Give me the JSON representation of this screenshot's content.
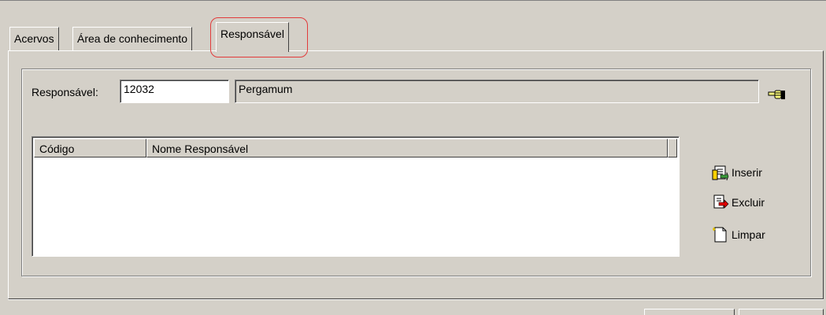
{
  "tabs": [
    {
      "label": "Acervos",
      "active": false
    },
    {
      "label": "Área de conhecimento",
      "active": false
    },
    {
      "label": "Responsável",
      "active": true
    }
  ],
  "responsavel": {
    "label": "Responsável:",
    "code_value": "12032",
    "name_value": "Pergamum"
  },
  "list": {
    "columns": [
      "Código",
      "Nome Responsável"
    ],
    "rows": []
  },
  "actions": {
    "insert_label": "Inserir",
    "delete_label": "Excluir",
    "clear_label": "Limpar"
  },
  "colors": {
    "face": "#d4d0c8",
    "highlight": "#e23b3b"
  }
}
